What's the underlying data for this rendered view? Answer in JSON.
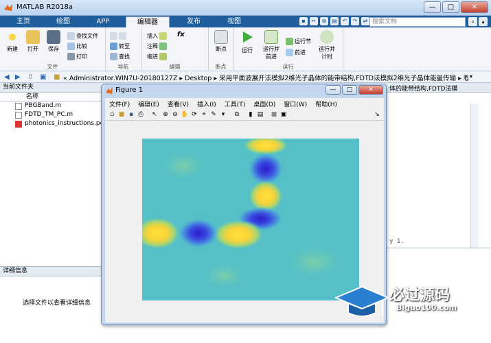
{
  "window": {
    "title": "MATLAB R2018a",
    "min_label": "—",
    "max_label": "□",
    "close_label": "✕"
  },
  "tabs": [
    {
      "label": "主页"
    },
    {
      "label": "绘图"
    },
    {
      "label": "APP"
    },
    {
      "label": "编辑器"
    },
    {
      "label": "发布"
    },
    {
      "label": "视图"
    }
  ],
  "search": {
    "placeholder": "搜索文档"
  },
  "ribbon": {
    "file_group": {
      "label": "文件",
      "new": "新建",
      "open": "打开",
      "save": "保存",
      "find_files": "查找文件",
      "compare": "比较",
      "print": "打印"
    },
    "nav_group": {
      "label": "导航",
      "goto": "转至",
      "find": "查找"
    },
    "edit_group": {
      "label": "编辑",
      "insert": "插入",
      "comment": "注释",
      "indent": "缩进",
      "fx": "fx"
    },
    "breakpoints_group": {
      "label": "断点",
      "breakpoints": "断点"
    },
    "run_group": {
      "label": "运行",
      "run": "运行",
      "run_advance": "运行并\n前进",
      "run_section": "运行节",
      "advance": "前进",
      "run_time": "运行并\n计时"
    }
  },
  "address": {
    "path": "« Administrator.WIN7U-20180127Z ▸ Desktop ▸ 采用平面波展开法模拟2维光子晶体的能带结构,FDTD法模拟2维光子晶体能量传输 ▸ 程序"
  },
  "left_panel": {
    "title": "当前文件夹",
    "name_header": "名称",
    "files": [
      {
        "name": "PBGBand.m"
      },
      {
        "name": "FDTD_TM_PC.m"
      },
      {
        "name": "photonics_instructions.pdf"
      }
    ],
    "details_title": "详细信息",
    "details_message": "选择文件以查看详细信息"
  },
  "editor": {
    "title_fragment": "体的能带结构,FDTD法模",
    "code_fragment": "y 1."
  },
  "figure": {
    "title": "Figure 1",
    "menu": [
      {
        "label": "文件(F)"
      },
      {
        "label": "编辑(E)"
      },
      {
        "label": "查看(V)"
      },
      {
        "label": "插入(I)"
      },
      {
        "label": "工具(T)"
      },
      {
        "label": "桌面(D)"
      },
      {
        "label": "窗口(W)"
      },
      {
        "label": "帮助(H)"
      }
    ]
  },
  "watermark": {
    "brand": "必过源码",
    "site": "Biguo100.com"
  },
  "colors": {
    "tab_bar": "#1f5f9d",
    "ribbon_bg": "#f3f5f8",
    "plot_bg": "#55c0c8",
    "hot": "#ffe23a",
    "cold": "#2a2ad0"
  }
}
